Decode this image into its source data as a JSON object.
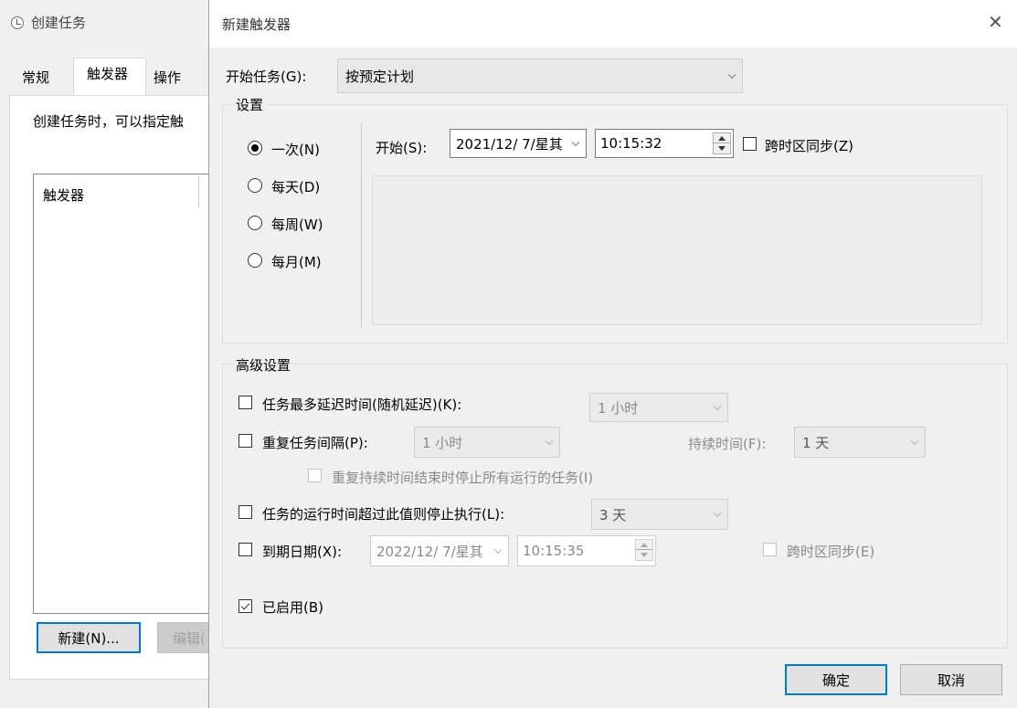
{
  "background_dialog": {
    "title": "创建任务",
    "tabs": [
      "常规",
      "触发器",
      "操作"
    ],
    "description": "创建任务时，可以指定触",
    "list_header": "触发器",
    "new_button": "新建(N)...",
    "edit_button": "编辑("
  },
  "dialog": {
    "title": "新建触发器",
    "start_task_label": "开始任务(G):",
    "start_task_value": "按预定计划",
    "settings_label": "设置",
    "schedule_options": [
      "一次(N)",
      "每天(D)",
      "每周(W)",
      "每月(M)"
    ],
    "selected_schedule": "一次(N)",
    "start_label": "开始(S):",
    "start_date": "2021/12/ 7/星其",
    "start_time": "10:15:32",
    "sync_timezone_label": "跨时区同步(Z)",
    "advanced_label": "高级设置",
    "delay": {
      "label": "任务最多延迟时间(随机延迟)(K):",
      "value": "1 小时",
      "checked": false
    },
    "repeat": {
      "label": "重复任务间隔(P):",
      "value": "1 小时",
      "checked": false,
      "duration_label": "持续时间(F):",
      "duration_value": "1 天",
      "stop_all_label": "重复持续时间结束时停止所有运行的任务(I)"
    },
    "stop_if_longer": {
      "label": "任务的运行时间超过此值则停止执行(L):",
      "value": "3 天",
      "checked": false
    },
    "expire": {
      "label": "到期日期(X):",
      "date": "2022/12/ 7/星其",
      "time": "10:15:35",
      "checked": false,
      "sync_label": "跨时区同步(E)"
    },
    "enabled": {
      "label": "已启用(B)",
      "checked": true
    },
    "ok_button": "确定",
    "cancel_button": "取消",
    "close_symbol": "✕"
  }
}
